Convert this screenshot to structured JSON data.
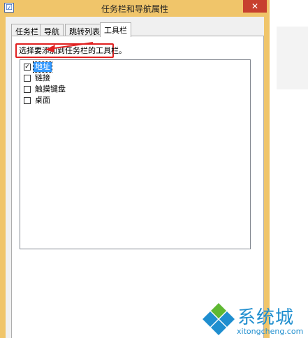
{
  "window": {
    "title": "任务栏和导航属性",
    "close_symbol": "✕"
  },
  "tabs": [
    {
      "label": "任务栏",
      "active": false
    },
    {
      "label": "导航",
      "active": false
    },
    {
      "label": "跳转列表",
      "active": false
    },
    {
      "label": "工具栏",
      "active": true
    }
  ],
  "toolbar_tab": {
    "instruction": "选择要添加到任务栏的工具栏。",
    "items": [
      {
        "label": "地址",
        "checked": true,
        "selected": true
      },
      {
        "label": "链接",
        "checked": false,
        "selected": false
      },
      {
        "label": "触摸键盘",
        "checked": false,
        "selected": false
      },
      {
        "label": "桌面",
        "checked": false,
        "selected": false
      }
    ]
  },
  "annotation": {
    "highlight_color": "#e02020"
  },
  "watermark": {
    "name": "系统城",
    "url": "xitongcheng.com",
    "color": "#1f8ecf"
  }
}
